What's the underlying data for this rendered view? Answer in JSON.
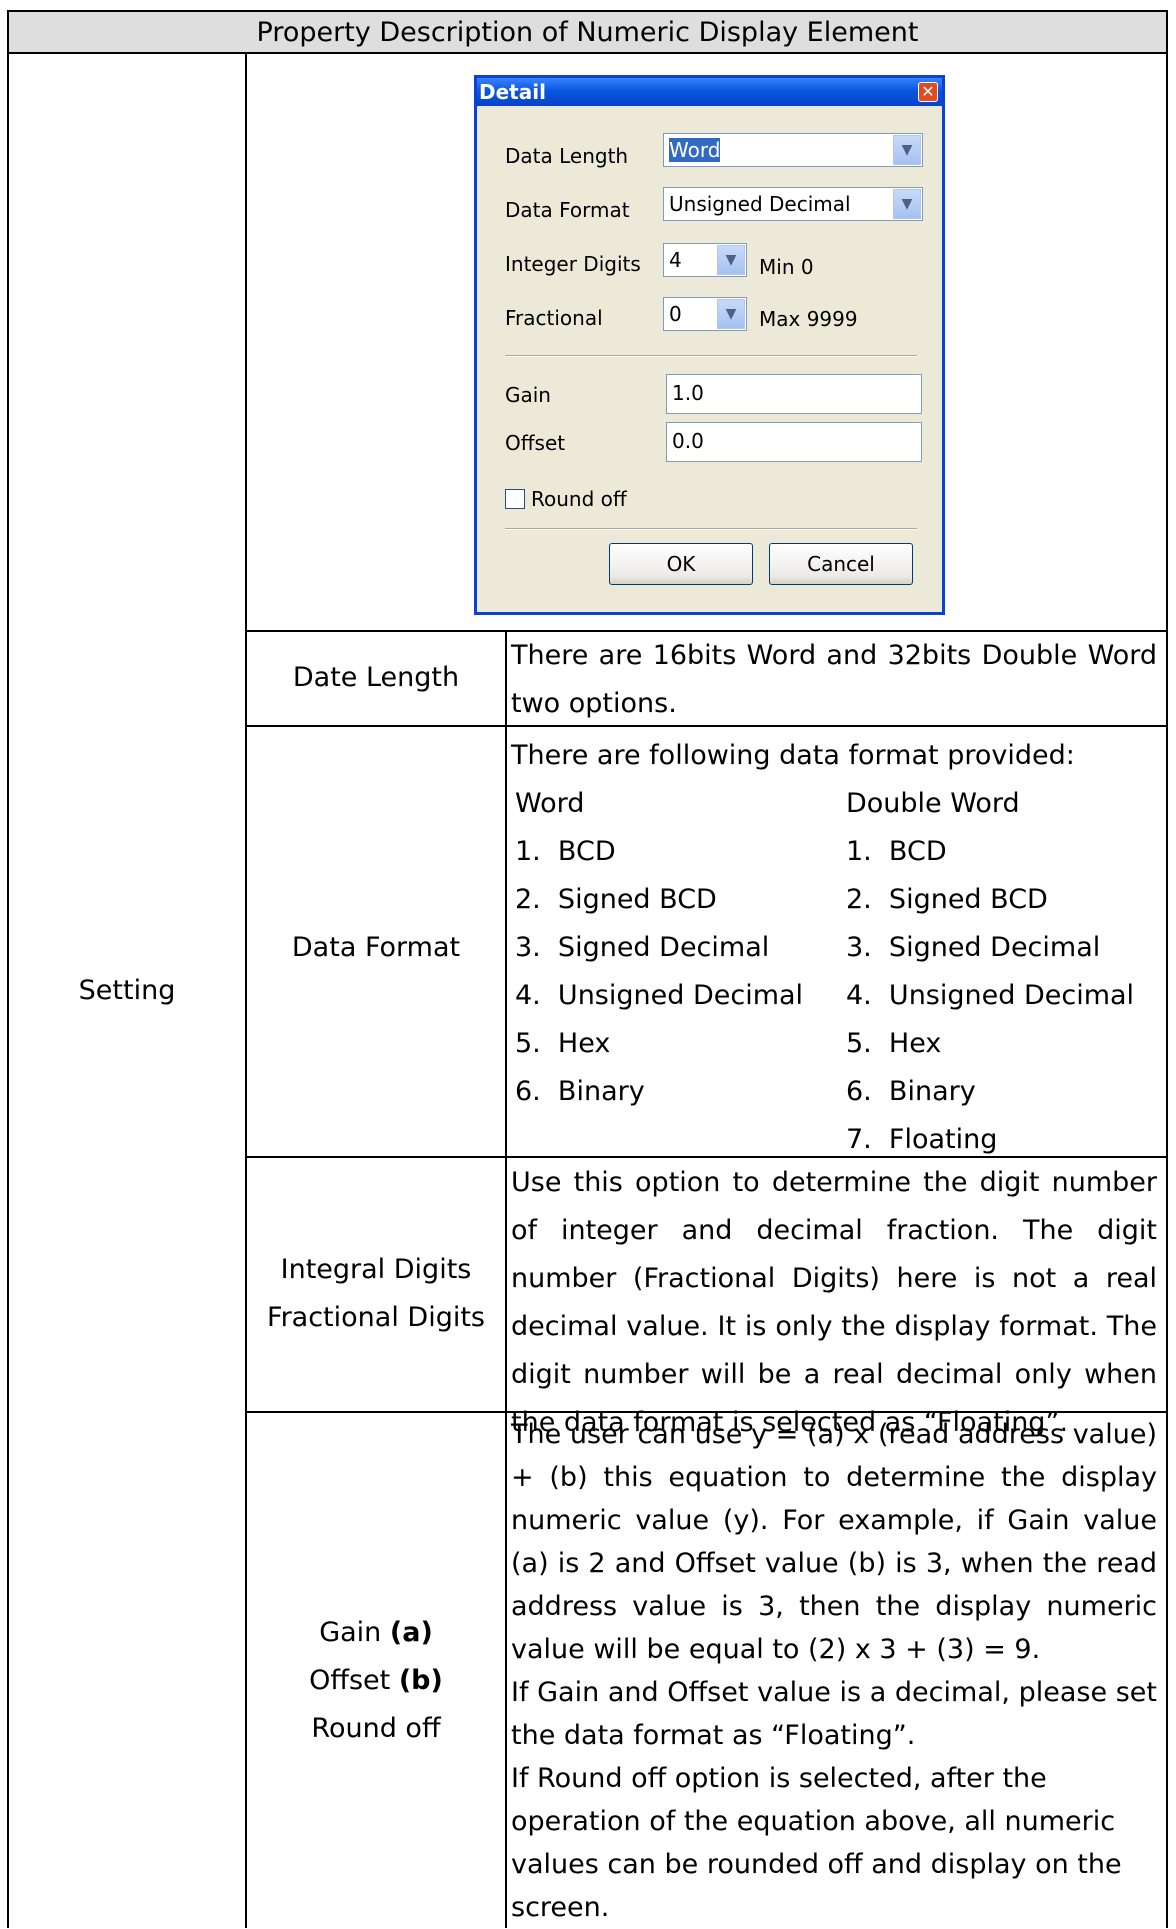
{
  "table": {
    "title": "Property Description of Numeric Display Element",
    "section": "Setting",
    "rows": [
      {
        "label_lines": [
          "Date Length"
        ],
        "text": "There are 16bits Word and 32bits Double Word two options."
      },
      {
        "label_lines": [
          "Data Format"
        ],
        "intro": "There are following data format provided:",
        "word_header": "Word",
        "double_header": "Double Word",
        "word_items": [
          "1.  BCD",
          "2.  Signed BCD",
          "3.  Signed Decimal",
          "4.  Unsigned Decimal",
          "5.  Hex",
          "6.  Binary"
        ],
        "double_items": [
          "1.  BCD",
          "2.  Signed BCD",
          "3.  Signed Decimal",
          "4.  Unsigned Decimal",
          "5.  Hex",
          "6.  Binary",
          "7.  Floating"
        ]
      },
      {
        "label_lines": [
          "Integral Digits",
          "Fractional Digits"
        ],
        "text": "Use this option to determine the digit number of integer and decimal fraction. The digit number (Fractional Digits) here is not a real decimal value. It is only the display format. The digit number will be a real decimal only when the data format is selected as “Floating”."
      },
      {
        "label_gain": "Gain",
        "label_gain_bold": "(a)",
        "label_offset": "Offset",
        "label_offset_bold": "(b)",
        "label_round": "Round off",
        "para1": "The user can use y = (a) x (read address value) + (b) this equation to determine the display numeric value (y). For example, if Gain value (a) is 2 and Offset value (b) is 3, when the read address value is 3, then the display numeric value will be equal to (2) x 3 + (3) = 9.",
        "para2": "If Gain and Offset value is a decimal, please set the data format as “Floating”.",
        "para3": "If Round off option is selected, after the operation of the equation above, all numeric values can be rounded off and display on the screen."
      }
    ]
  },
  "dialog": {
    "title": "Detail",
    "close_glyph": "✕",
    "data_length_label": "Data Length",
    "data_length_value": "Word",
    "data_format_label": "Data Format",
    "data_format_value": "Unsigned Decimal",
    "integer_digits_label": "Integer Digits",
    "integer_digits_value": "4",
    "fractional_label": "Fractional",
    "fractional_value": "0",
    "min_text": "Min 0",
    "max_text": "Max 9999",
    "gain_label": "Gain",
    "gain_value": "1.0",
    "offset_label": "Offset",
    "offset_value": "0.0",
    "round_off_label": "Round off",
    "round_off_checked": false,
    "ok_label": "OK",
    "cancel_label": "Cancel",
    "dropdown_glyph": "▼"
  }
}
